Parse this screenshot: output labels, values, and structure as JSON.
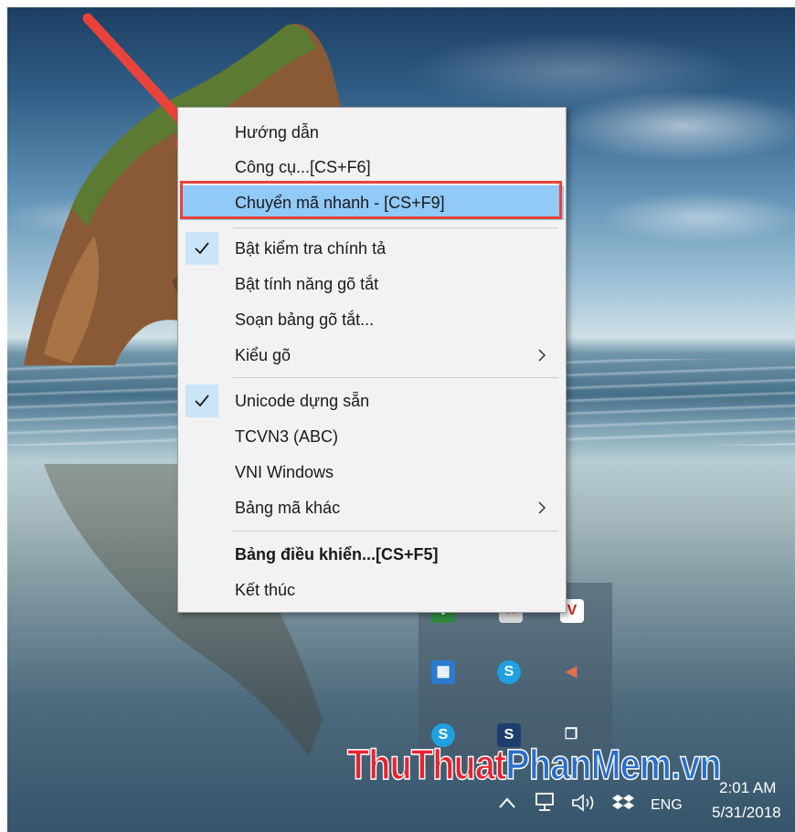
{
  "context_menu": {
    "items": [
      {
        "label": "Hướng dẫn"
      },
      {
        "label": "Công cụ...[CS+F6]"
      },
      {
        "label": "Chuyển mã nhanh - [CS+F9]"
      },
      {
        "label": "Bật kiểm tra chính tả"
      },
      {
        "label": "Bật tính năng gõ tắt"
      },
      {
        "label": "Soạn bảng gõ tắt..."
      },
      {
        "label": "Kiểu gõ"
      },
      {
        "label": "Unicode dựng sẵn"
      },
      {
        "label": "TCVN3 (ABC)"
      },
      {
        "label": "VNI Windows"
      },
      {
        "label": "Bảng mã khác"
      },
      {
        "label": "Bảng điều khiển...[CS+F5]"
      },
      {
        "label": "Kết thúc"
      }
    ],
    "checked_items": [
      "Bật kiểm tra chính tả",
      "Unicode dựng sẵn"
    ],
    "submenu_items": [
      "Kiểu gõ",
      "Bảng mã khác"
    ],
    "highlighted_item": "Chuyển mã nhanh - [CS+F9]"
  },
  "annotation": {
    "arrow_color": "#e8433a",
    "frame_color": "#e8433a"
  },
  "tray_overflow": {
    "icons": [
      "unikey-icon",
      "skype-icon-partial",
      "antivirus-icon",
      "network-app-icon",
      "skype-icon",
      "speaker-icon",
      "skype-for-business-icon",
      "sway-icon",
      "window-switcher-icon"
    ]
  },
  "taskbar": {
    "icons": [
      "chevron-up-icon",
      "network-icon",
      "volume-icon",
      "dropbox-icon"
    ],
    "language": "ENG",
    "time": "2:01 AM",
    "date": "5/31/2018"
  },
  "watermark": {
    "part1": "ThuThuat",
    "part2": "PhanMem",
    "part3": ".vn"
  },
  "colors": {
    "menu_background": "#f2f2f2",
    "menu_highlight": "#91c9f7",
    "check_box": "#cce4f7"
  }
}
